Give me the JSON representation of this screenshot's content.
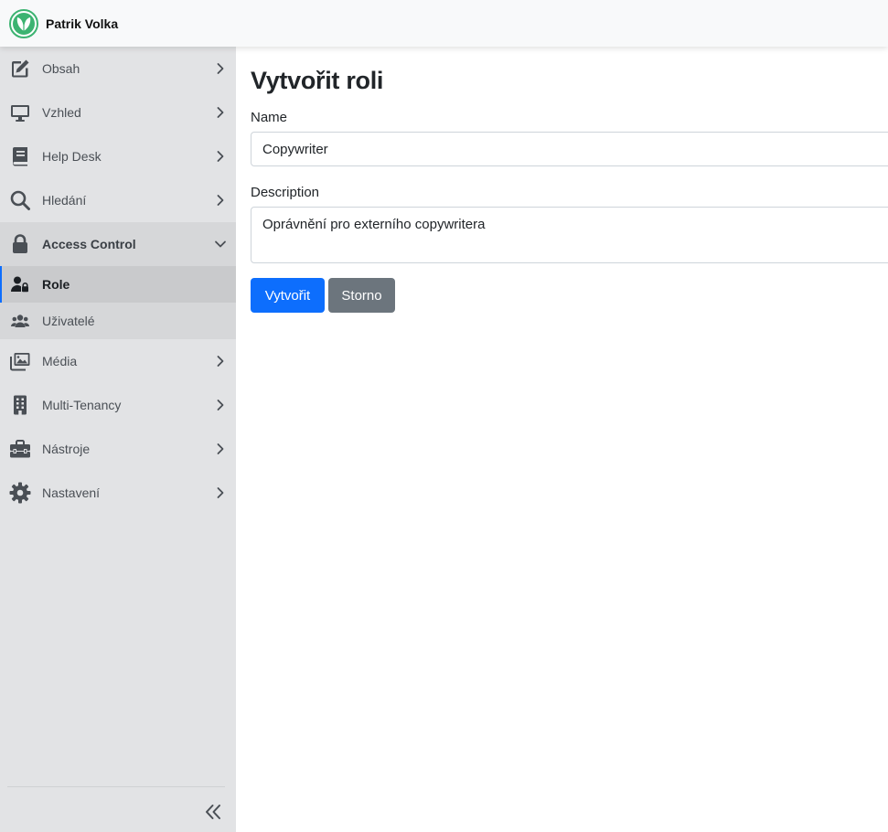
{
  "header": {
    "user_name": "Patrik Volka"
  },
  "sidebar": {
    "items": [
      {
        "label": "Obsah",
        "icon": "edit-icon"
      },
      {
        "label": "Vzhled",
        "icon": "monitor-icon"
      },
      {
        "label": "Help Desk",
        "icon": "book-icon"
      },
      {
        "label": "Hledání",
        "icon": "search-icon"
      },
      {
        "label": "Access Control",
        "icon": "lock-icon",
        "expanded": true,
        "children": [
          {
            "label": "Role",
            "icon": "user-lock-icon",
            "active": true
          },
          {
            "label": "Uživatelé",
            "icon": "users-icon"
          }
        ]
      },
      {
        "label": "Média",
        "icon": "images-icon"
      },
      {
        "label": "Multi-Tenancy",
        "icon": "building-icon"
      },
      {
        "label": "Nástroje",
        "icon": "toolbox-icon"
      },
      {
        "label": "Nastavení",
        "icon": "gear-icon"
      }
    ]
  },
  "main": {
    "title": "Vytvořit roli",
    "name_label": "Name",
    "name_value": "Copywriter",
    "description_label": "Description",
    "description_value": "Oprávnění pro externího copywritera",
    "create_label": "Vytvořit",
    "cancel_label": "Storno"
  },
  "colors": {
    "primary": "#0d6efd",
    "secondary": "#6c757d",
    "sidebar_bg": "#e2e3e5",
    "brand_green": "#3cb371"
  }
}
